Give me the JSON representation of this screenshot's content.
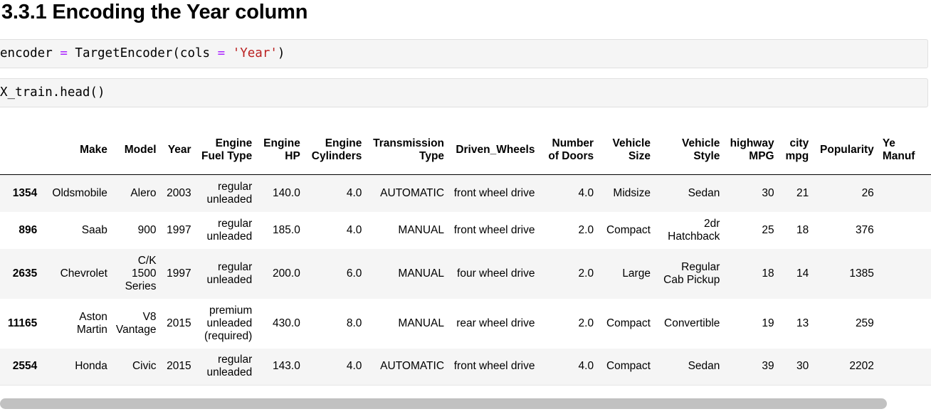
{
  "heading": "3.3.1 Encoding the Year column",
  "cells": {
    "cell1": {
      "var": "encoder",
      "eq": "=",
      "call_open": "TargetEncoder(cols",
      "eq2": "=",
      "str": "'Year'",
      "close": ")"
    },
    "cell2": {
      "code": "X_train.head()"
    }
  },
  "table": {
    "columns": [
      "",
      "Make",
      "Model",
      "Year",
      "Engine Fuel Type",
      "Engine HP",
      "Engine Cylinders",
      "Transmission Type",
      "Driven_Wheels",
      "Number of Doors",
      "Vehicle Size",
      "Vehicle Style",
      "highway MPG",
      "city mpg",
      "Popularity",
      "Ye Manuf"
    ],
    "rows": [
      [
        "1354",
        "Oldsmobile",
        "Alero",
        "2003",
        "regular unleaded",
        "140.0",
        "4.0",
        "AUTOMATIC",
        "front wheel drive",
        "4.0",
        "Midsize",
        "Sedan",
        "30",
        "21",
        "26",
        ""
      ],
      [
        "896",
        "Saab",
        "900",
        "1997",
        "regular unleaded",
        "185.0",
        "4.0",
        "MANUAL",
        "front wheel drive",
        "2.0",
        "Compact",
        "2dr Hatchback",
        "25",
        "18",
        "376",
        ""
      ],
      [
        "2635",
        "Chevrolet",
        "C/K 1500 Series",
        "1997",
        "regular unleaded",
        "200.0",
        "6.0",
        "MANUAL",
        "four wheel drive",
        "2.0",
        "Large",
        "Regular Cab Pickup",
        "18",
        "14",
        "1385",
        ""
      ],
      [
        "11165",
        "Aston Martin",
        "V8 Vantage",
        "2015",
        "premium unleaded (required)",
        "430.0",
        "8.0",
        "MANUAL",
        "rear wheel drive",
        "2.0",
        "Compact",
        "Convertible",
        "19",
        "13",
        "259",
        ""
      ],
      [
        "2554",
        "Honda",
        "Civic",
        "2015",
        "regular unleaded",
        "143.0",
        "4.0",
        "AUTOMATIC",
        "front wheel drive",
        "4.0",
        "Compact",
        "Sedan",
        "39",
        "30",
        "2202",
        ""
      ]
    ]
  }
}
